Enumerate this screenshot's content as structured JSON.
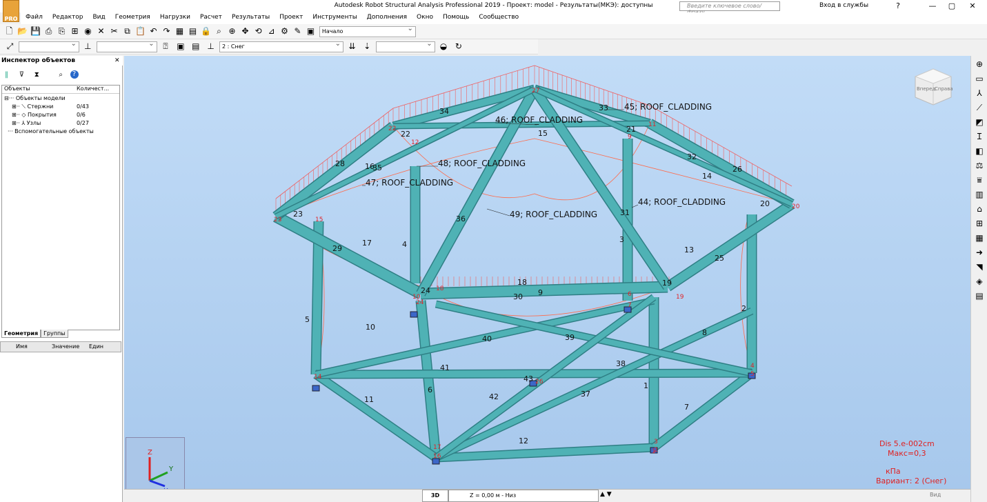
{
  "window": {
    "title": "Autodesk Robot Structural Analysis Professional 2019 - Проект: model - Результаты(МКЭ): доступны",
    "logo": "PRO",
    "search_placeholder": "Введите ключевое слово/фразу",
    "login": "Вход в службы",
    "help": "?",
    "minimize": "—",
    "maximize": "▢",
    "close": "✕"
  },
  "menu": [
    "Файл",
    "Редактор",
    "Вид",
    "Геометрия",
    "Нагрузки",
    "Расчет",
    "Результаты",
    "Проект",
    "Инструменты",
    "Дополнения",
    "Окно",
    "Помощь",
    "Сообщество"
  ],
  "toolbar1": {
    "icons": [
      "new-icon",
      "open-icon",
      "save-icon",
      "print-icon",
      "print-preview-icon",
      "page-setup-icon",
      "screen-capture-icon",
      "delete-icon",
      "cut-icon",
      "copy-icon",
      "paste-icon",
      "undo-icon",
      "redo-icon",
      "table-icon",
      "table-edit-icon",
      "lock-icon",
      "zoom-icon",
      "zoom-window-icon",
      "pan-icon",
      "rotate-icon",
      "measure-icon",
      "calc-icon",
      "tools-icon",
      "layout-icon"
    ],
    "layout_value": "Начало"
  },
  "toolbar2": {
    "case_value": "2 : Снег",
    "empty1": "",
    "empty2": ""
  },
  "inspector": {
    "title": "Инспектор объектов",
    "col_objects": "Объекты",
    "col_count": "Количест...",
    "root": "Объекты модели",
    "items": [
      {
        "label": "Стержни",
        "count": "0/43"
      },
      {
        "label": "Покрытия",
        "count": "0/6"
      },
      {
        "label": "Узлы",
        "count": "0/27"
      }
    ],
    "aux": "Вспомогательные объекты",
    "tab_geometry": "Геометрия",
    "tab_groups": "Группы",
    "prop_name": "Имя",
    "prop_value": "Значение",
    "prop_unit": "Един"
  },
  "model": {
    "member_labels": [
      "34",
      "33",
      "22",
      "28",
      "16",
      "35",
      "17",
      "23",
      "29",
      "4",
      "5",
      "10",
      "11",
      "6",
      "41",
      "40",
      "39",
      "42",
      "37",
      "43",
      "38",
      "36",
      "30",
      "9",
      "18",
      "15",
      "21",
      "31",
      "32",
      "26",
      "14",
      "20",
      "13",
      "25",
      "3",
      "24",
      "19",
      "8",
      "2",
      "1",
      "12",
      "7"
    ],
    "node_labels": [
      "27",
      "11",
      "12",
      "22",
      "23",
      "15",
      "18",
      "24",
      "10",
      "7",
      "9",
      "6",
      "20",
      "14",
      "26",
      "3",
      "2",
      "1",
      "4",
      "5",
      "16",
      "17",
      "19"
    ],
    "claddings": [
      "46; ROOF_CLADDING",
      "45; ROOF_CLADDING",
      "48; ROOF_CLADDING",
      "47; ROOF_CLADDING",
      "49; ROOF_CLADDING",
      "44; ROOF_CLADDING"
    ]
  },
  "viewcube": {
    "left": "Вперед",
    "right": "Справа"
  },
  "axes": {
    "z": "Z",
    "y": "Y",
    "x": "X"
  },
  "legend": {
    "dis": "Dis  5.e-002cm",
    "max": "Макс=0,3",
    "unit": "кПа",
    "variant": "Вариант: 2 (Снег)"
  },
  "status": {
    "view": "3D",
    "z_level": "Z = 0,00 м - Низ",
    "vid": "Вид"
  },
  "colors": {
    "member": "#4fb2b5",
    "member_dark": "#2f7f85",
    "node_label": "#e0242a",
    "load": "#f06060",
    "deform": "#ff6a4a"
  }
}
